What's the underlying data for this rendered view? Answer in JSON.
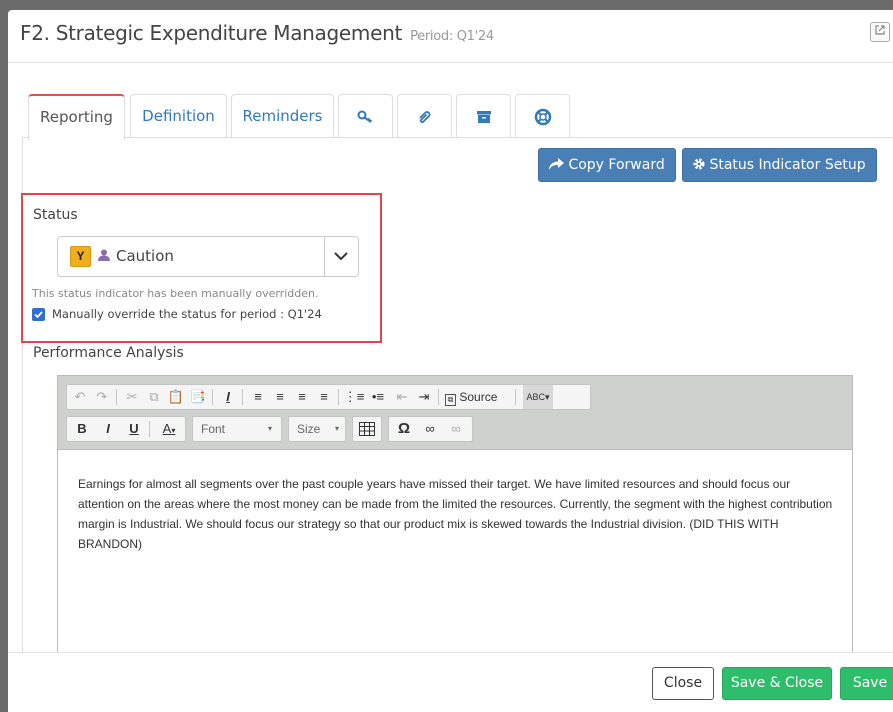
{
  "header": {
    "title": "F2. Strategic Expenditure Management",
    "period": "Period: Q1'24"
  },
  "tabs": [
    {
      "label": "Reporting",
      "active": true
    },
    {
      "label": "Definition"
    },
    {
      "label": "Reminders"
    },
    {
      "icon": "key-icon"
    },
    {
      "icon": "paperclip-icon"
    },
    {
      "icon": "archive-icon"
    },
    {
      "icon": "lifebuoy-icon"
    }
  ],
  "actions": {
    "copy_forward": "Copy Forward",
    "status_setup": "Status Indicator Setup"
  },
  "status": {
    "label": "Status",
    "badge": "Y",
    "value": "Caution",
    "help": "This status indicator has been manually overridden.",
    "override_label": "Manually override the status for period : Q1'24",
    "override_checked": true
  },
  "performance": {
    "label": "Performance Analysis",
    "toolbar": {
      "source": "Source",
      "font": "Font",
      "size": "Size",
      "bold": "B",
      "italic": "I",
      "underline": "U",
      "font_color": "A"
    },
    "text": "Earnings for almost all segments over the past couple years have missed their target.  We have limited resources and should focus our attention on the areas where the most money can be made from the limited the resources.  Currently, the segment with the highest contribution margin is Industrial.  We should focus our strategy so that our product mix is skewed towards the Industrial division.  (DID THIS WITH BRANDON)"
  },
  "footer": {
    "close": "Close",
    "save_close": "Save & Close",
    "save": "Save"
  },
  "colors": {
    "accent_blue": "#4a7fb5",
    "save_green": "#2ebd6b",
    "status_yellow": "#f0ad1e",
    "highlight_red": "#e0474c"
  }
}
